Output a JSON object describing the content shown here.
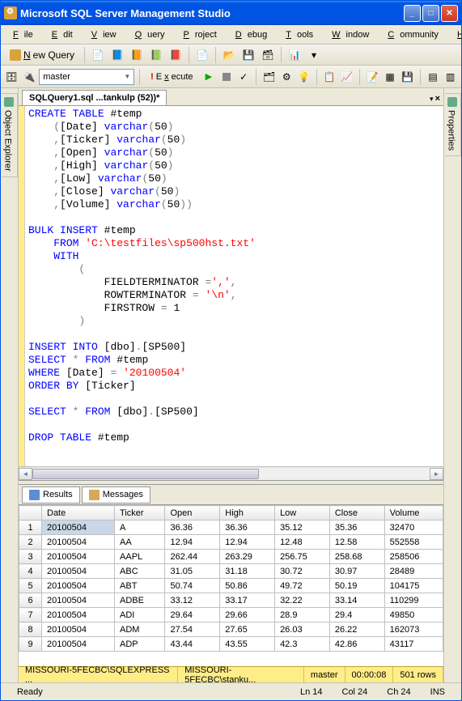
{
  "window": {
    "title": "Microsoft SQL Server Management Studio"
  },
  "menu": {
    "file": "File",
    "edit": "Edit",
    "view": "View",
    "query": "Query",
    "project": "Project",
    "debug": "Debug",
    "tools": "Tools",
    "window": "Window",
    "community": "Community",
    "help": "Help"
  },
  "toolbar": {
    "newquery": "New Query",
    "execute": "Execute"
  },
  "combo": {
    "db": "master"
  },
  "tab": {
    "label": "SQLQuery1.sql ...tankulp (52))*"
  },
  "side": {
    "left": "Object Explorer",
    "right": "Properties"
  },
  "code_lines": [
    {
      "t": [
        {
          "c": "kw",
          "v": "CREATE"
        },
        {
          "c": "",
          "v": " "
        },
        {
          "c": "kw",
          "v": "TABLE"
        },
        {
          "c": "",
          "v": " #temp"
        }
      ]
    },
    {
      "t": [
        {
          "c": "",
          "v": "    "
        },
        {
          "c": "gray",
          "v": "("
        },
        {
          "c": "",
          "v": "[Date] "
        },
        {
          "c": "kw",
          "v": "varchar"
        },
        {
          "c": "gray",
          "v": "("
        },
        {
          "c": "",
          "v": "50"
        },
        {
          "c": "gray",
          "v": ")"
        }
      ]
    },
    {
      "t": [
        {
          "c": "",
          "v": "    "
        },
        {
          "c": "gray",
          "v": ","
        },
        {
          "c": "",
          "v": "[Ticker] "
        },
        {
          "c": "kw",
          "v": "varchar"
        },
        {
          "c": "gray",
          "v": "("
        },
        {
          "c": "",
          "v": "50"
        },
        {
          "c": "gray",
          "v": ")"
        }
      ]
    },
    {
      "t": [
        {
          "c": "",
          "v": "    "
        },
        {
          "c": "gray",
          "v": ","
        },
        {
          "c": "",
          "v": "[Open] "
        },
        {
          "c": "kw",
          "v": "varchar"
        },
        {
          "c": "gray",
          "v": "("
        },
        {
          "c": "",
          "v": "50"
        },
        {
          "c": "gray",
          "v": ")"
        }
      ]
    },
    {
      "t": [
        {
          "c": "",
          "v": "    "
        },
        {
          "c": "gray",
          "v": ","
        },
        {
          "c": "",
          "v": "[High] "
        },
        {
          "c": "kw",
          "v": "varchar"
        },
        {
          "c": "gray",
          "v": "("
        },
        {
          "c": "",
          "v": "50"
        },
        {
          "c": "gray",
          "v": ")"
        }
      ]
    },
    {
      "t": [
        {
          "c": "",
          "v": "    "
        },
        {
          "c": "gray",
          "v": ","
        },
        {
          "c": "",
          "v": "[Low] "
        },
        {
          "c": "kw",
          "v": "varchar"
        },
        {
          "c": "gray",
          "v": "("
        },
        {
          "c": "",
          "v": "50"
        },
        {
          "c": "gray",
          "v": ")"
        }
      ]
    },
    {
      "t": [
        {
          "c": "",
          "v": "    "
        },
        {
          "c": "gray",
          "v": ","
        },
        {
          "c": "",
          "v": "[Close] "
        },
        {
          "c": "kw",
          "v": "varchar"
        },
        {
          "c": "gray",
          "v": "("
        },
        {
          "c": "",
          "v": "50"
        },
        {
          "c": "gray",
          "v": ")"
        }
      ]
    },
    {
      "t": [
        {
          "c": "",
          "v": "    "
        },
        {
          "c": "gray",
          "v": ","
        },
        {
          "c": "",
          "v": "[Volume] "
        },
        {
          "c": "kw",
          "v": "varchar"
        },
        {
          "c": "gray",
          "v": "("
        },
        {
          "c": "",
          "v": "50"
        },
        {
          "c": "gray",
          "v": "))"
        }
      ]
    },
    {
      "t": [
        {
          "c": "",
          "v": ""
        }
      ]
    },
    {
      "t": [
        {
          "c": "kw",
          "v": "BULK"
        },
        {
          "c": "",
          "v": " "
        },
        {
          "c": "kw",
          "v": "INSERT"
        },
        {
          "c": "",
          "v": " #temp"
        }
      ]
    },
    {
      "t": [
        {
          "c": "",
          "v": "    "
        },
        {
          "c": "kw",
          "v": "FROM"
        },
        {
          "c": "",
          "v": " "
        },
        {
          "c": "str",
          "v": "'C:\\testfiles\\sp500hst.txt'"
        }
      ]
    },
    {
      "t": [
        {
          "c": "",
          "v": "    "
        },
        {
          "c": "kw",
          "v": "WITH"
        }
      ]
    },
    {
      "t": [
        {
          "c": "",
          "v": "        "
        },
        {
          "c": "gray",
          "v": "("
        }
      ]
    },
    {
      "t": [
        {
          "c": "",
          "v": "            FIELDTERMINATOR "
        },
        {
          "c": "gray",
          "v": "="
        },
        {
          "c": "str",
          "v": "','"
        },
        {
          "c": "gray",
          "v": ","
        }
      ]
    },
    {
      "t": [
        {
          "c": "",
          "v": "            ROWTERMINATOR "
        },
        {
          "c": "gray",
          "v": "="
        },
        {
          "c": "",
          "v": " "
        },
        {
          "c": "str",
          "v": "'\\n'"
        },
        {
          "c": "gray",
          "v": ","
        }
      ]
    },
    {
      "t": [
        {
          "c": "",
          "v": "            FIRSTROW "
        },
        {
          "c": "gray",
          "v": "="
        },
        {
          "c": "",
          "v": " 1"
        }
      ]
    },
    {
      "t": [
        {
          "c": "",
          "v": "        "
        },
        {
          "c": "gray",
          "v": ")"
        }
      ]
    },
    {
      "t": [
        {
          "c": "",
          "v": ""
        }
      ]
    },
    {
      "t": [
        {
          "c": "kw",
          "v": "INSERT"
        },
        {
          "c": "",
          "v": " "
        },
        {
          "c": "kw",
          "v": "INTO"
        },
        {
          "c": "",
          "v": " [dbo]"
        },
        {
          "c": "gray",
          "v": "."
        },
        {
          "c": "",
          "v": "[SP500]"
        }
      ]
    },
    {
      "t": [
        {
          "c": "kw",
          "v": "SELECT"
        },
        {
          "c": "",
          "v": " "
        },
        {
          "c": "gray",
          "v": "*"
        },
        {
          "c": "",
          "v": " "
        },
        {
          "c": "kw",
          "v": "FROM"
        },
        {
          "c": "",
          "v": " #temp"
        }
      ]
    },
    {
      "t": [
        {
          "c": "kw",
          "v": "WHERE"
        },
        {
          "c": "",
          "v": " [Date] "
        },
        {
          "c": "gray",
          "v": "="
        },
        {
          "c": "",
          "v": " "
        },
        {
          "c": "str",
          "v": "'20100504'"
        }
      ]
    },
    {
      "t": [
        {
          "c": "kw",
          "v": "ORDER"
        },
        {
          "c": "",
          "v": " "
        },
        {
          "c": "kw",
          "v": "BY"
        },
        {
          "c": "",
          "v": " [Ticker]"
        }
      ]
    },
    {
      "t": [
        {
          "c": "",
          "v": ""
        }
      ]
    },
    {
      "t": [
        {
          "c": "kw",
          "v": "SELECT"
        },
        {
          "c": "",
          "v": " "
        },
        {
          "c": "gray",
          "v": "*"
        },
        {
          "c": "",
          "v": " "
        },
        {
          "c": "kw",
          "v": "FROM"
        },
        {
          "c": "",
          "v": " [dbo]"
        },
        {
          "c": "gray",
          "v": "."
        },
        {
          "c": "",
          "v": "[SP500]"
        }
      ]
    },
    {
      "t": [
        {
          "c": "",
          "v": ""
        }
      ]
    },
    {
      "t": [
        {
          "c": "kw",
          "v": "DROP"
        },
        {
          "c": "",
          "v": " "
        },
        {
          "c": "kw",
          "v": "TABLE"
        },
        {
          "c": "",
          "v": " #temp"
        }
      ]
    }
  ],
  "results": {
    "tab_results": "Results",
    "tab_messages": "Messages",
    "columns": [
      "",
      "Date",
      "Ticker",
      "Open",
      "High",
      "Low",
      "Close",
      "Volume"
    ],
    "rows": [
      [
        "1",
        "20100504",
        "A",
        "36.36",
        "36.36",
        "35.12",
        "35.36",
        "32470"
      ],
      [
        "2",
        "20100504",
        "AA",
        "12.94",
        "12.94",
        "12.48",
        "12.58",
        "552558"
      ],
      [
        "3",
        "20100504",
        "AAPL",
        "262.44",
        "263.29",
        "256.75",
        "258.68",
        "258506"
      ],
      [
        "4",
        "20100504",
        "ABC",
        "31.05",
        "31.18",
        "30.72",
        "30.97",
        "28489"
      ],
      [
        "5",
        "20100504",
        "ABT",
        "50.74",
        "50.86",
        "49.72",
        "50.19",
        "104175"
      ],
      [
        "6",
        "20100504",
        "ADBE",
        "33.12",
        "33.17",
        "32.22",
        "33.14",
        "110299"
      ],
      [
        "7",
        "20100504",
        "ADI",
        "29.64",
        "29.66",
        "28.9",
        "29.4",
        "49850"
      ],
      [
        "8",
        "20100504",
        "ADM",
        "27.54",
        "27.65",
        "26.03",
        "26.22",
        "162073"
      ],
      [
        "9",
        "20100504",
        "ADP",
        "43.44",
        "43.55",
        "42.3",
        "42.86",
        "43117"
      ]
    ]
  },
  "strip": {
    "server": "MISSOURI-5FECBC\\SQLEXPRESS ...",
    "user": "MISSOURI-5FECBC\\stanku...",
    "db": "master",
    "time": "00:00:08",
    "rows": "501 rows"
  },
  "status": {
    "ready": "Ready",
    "ln": "Ln 14",
    "col": "Col 24",
    "ch": "Ch 24",
    "ins": "INS"
  }
}
